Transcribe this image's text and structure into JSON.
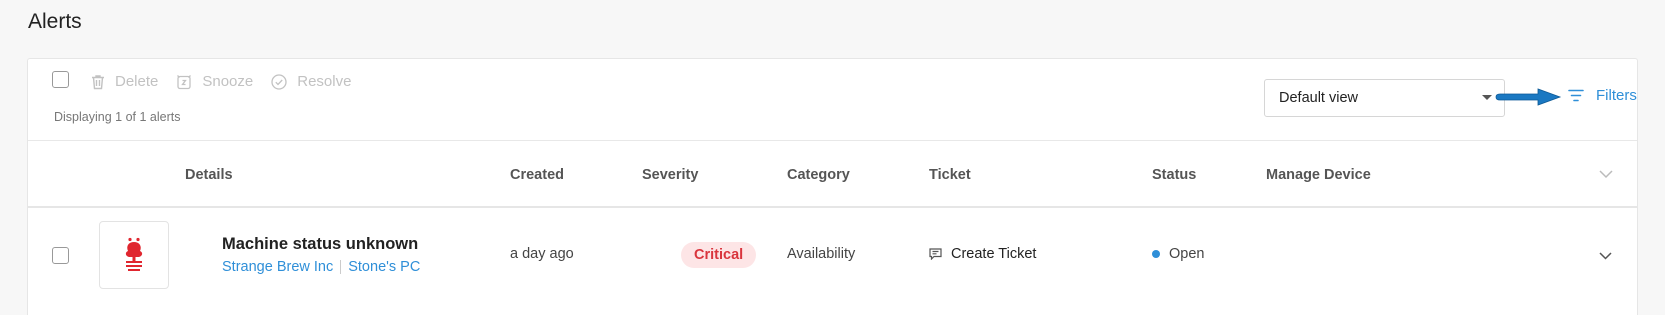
{
  "page": {
    "title": "Alerts"
  },
  "toolbar": {
    "actions": [
      {
        "label": "Delete",
        "icon": "trash-icon"
      },
      {
        "label": "Snooze",
        "icon": "alarm-clock-icon"
      },
      {
        "label": "Resolve",
        "icon": "check-circle-icon"
      }
    ],
    "displaying": "Displaying 1 of 1 alerts",
    "view_select": {
      "value": "Default view"
    },
    "filters_label": "Filters"
  },
  "table": {
    "columns": [
      "Details",
      "Created",
      "Severity",
      "Category",
      "Ticket",
      "Status",
      "Manage Device"
    ],
    "rows": [
      {
        "title": "Machine status unknown",
        "organization": "Strange Brew Inc",
        "device": "Stone's PC",
        "created": "a day ago",
        "severity": "Critical",
        "category": "Availability",
        "ticket": "Create Ticket",
        "status": "Open"
      }
    ]
  },
  "colors": {
    "accent": "#2f8fd8",
    "critical_text": "#d9353d",
    "critical_bg": "#fde5e6",
    "arrow": "#1a78c2",
    "logo": "#e0262f"
  }
}
